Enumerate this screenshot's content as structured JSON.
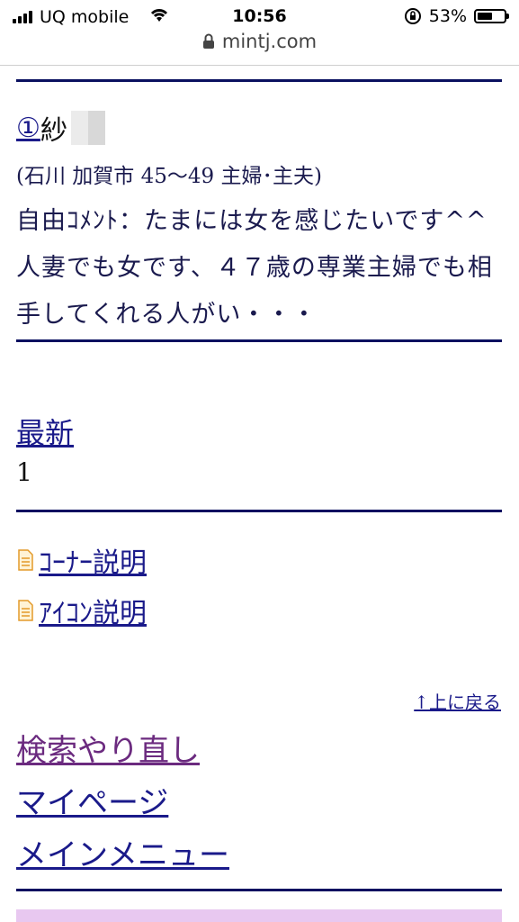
{
  "status_bar": {
    "carrier": "UQ mobile",
    "time": "10:56",
    "battery_percent": "53%",
    "battery_level": 0.53
  },
  "browser": {
    "url": "mintj.com"
  },
  "post": {
    "number": "①",
    "name": "紗",
    "meta": "(石川 加賀市 45〜49 主婦･主夫)",
    "comment": "自由ｺﾒﾝﾄ：たまには女を感じたいです^^人妻でも女です、４７歳の専業主婦でも相手してくれる人がい・・・"
  },
  "pagination": {
    "latest_label": "最新",
    "count": "1"
  },
  "help_links": [
    {
      "label": "ｺｰﾅｰ説明"
    },
    {
      "label": "ｱｲｺﾝ説明"
    }
  ],
  "back_to_top": "↑上に戻る",
  "nav": {
    "search_again": "検索やり直し",
    "my_page": "マイページ",
    "main_menu": "メインメニュー"
  },
  "colors": {
    "rule": "#0a1060",
    "link": "#1a1a8a",
    "visited": "#6b2a7f",
    "footer_band": "#e8c8f0"
  }
}
